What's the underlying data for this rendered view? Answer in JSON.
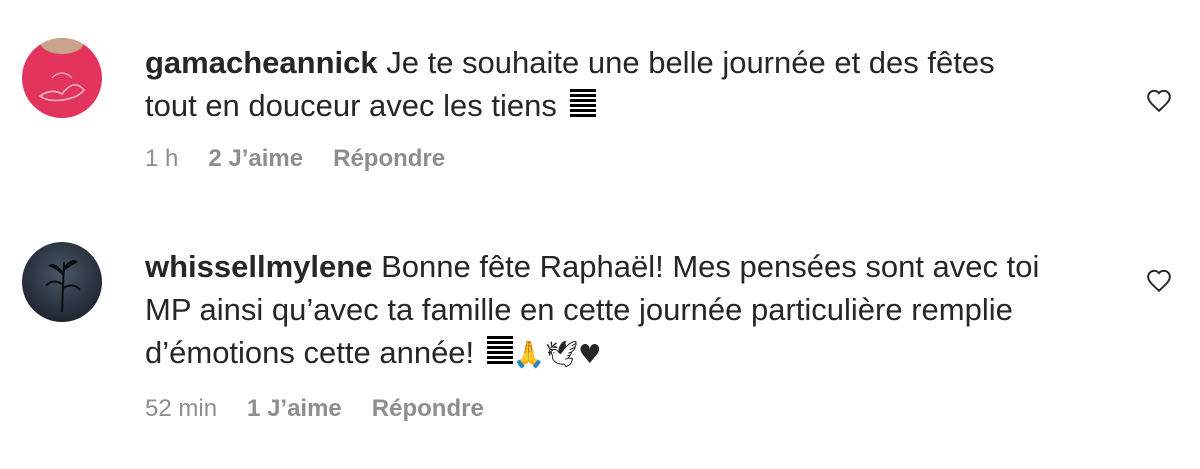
{
  "comments": [
    {
      "username": "gamacheannick",
      "text": "Je te souhaite une belle journée et des fêtes tout en douceur avec les tiens",
      "emojis": "",
      "time": "1 h",
      "likes": "2 J’aime",
      "reply": "Répondre",
      "avatar_color": "#e2345c",
      "like_icon": "heart-outline-icon"
    },
    {
      "username": "whissellmylene",
      "text": "Bonne fête Raphaël! Mes pensées sont avec toi MP ainsi qu’avec ta famille en cette journée particulière remplie d’émotions cette année!",
      "emojis": "🙏🕊♥",
      "time": "52 min",
      "likes": "1 J’aime",
      "reply": "Répondre",
      "avatar_color": "#26303d",
      "like_icon": "heart-outline-icon"
    }
  ],
  "colors": {
    "text": "#262626",
    "meta": "#8e8e8e",
    "background": "#ffffff"
  }
}
